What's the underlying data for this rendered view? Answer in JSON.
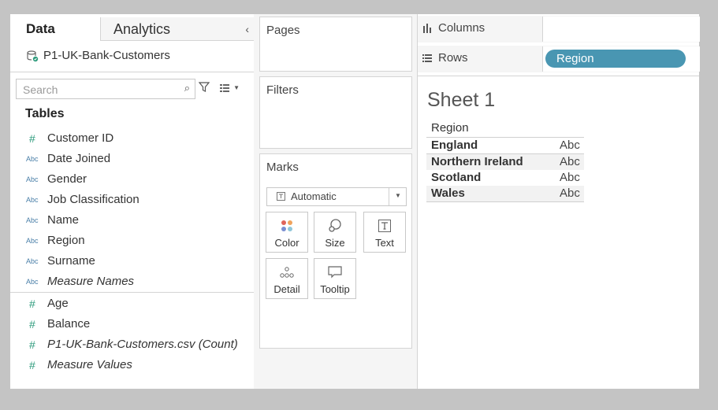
{
  "left_pane": {
    "tabs": {
      "data": "Data",
      "analytics": "Analytics"
    },
    "collapse_glyph": "‹",
    "datasource": "P1-UK-Bank-Customers",
    "search_placeholder": "Search",
    "tables_heading": "Tables",
    "dimensions": [
      {
        "icon": "#",
        "type": "number",
        "label": "Customer ID",
        "italic": false
      },
      {
        "icon": "Abc",
        "type": "string",
        "label": "Date Joined",
        "italic": false
      },
      {
        "icon": "Abc",
        "type": "string",
        "label": "Gender",
        "italic": false
      },
      {
        "icon": "Abc",
        "type": "string",
        "label": "Job Classification",
        "italic": false
      },
      {
        "icon": "Abc",
        "type": "string",
        "label": "Name",
        "italic": false
      },
      {
        "icon": "Abc",
        "type": "string",
        "label": "Region",
        "italic": false
      },
      {
        "icon": "Abc",
        "type": "string",
        "label": "Surname",
        "italic": false
      },
      {
        "icon": "Abc",
        "type": "string",
        "label": "Measure Names",
        "italic": true
      }
    ],
    "measures": [
      {
        "icon": "#",
        "type": "number",
        "label": "Age",
        "italic": false
      },
      {
        "icon": "#",
        "type": "number",
        "label": "Balance",
        "italic": false
      },
      {
        "icon": "#",
        "type": "number",
        "label": "P1-UK-Bank-Customers.csv (Count)",
        "italic": true
      },
      {
        "icon": "#",
        "type": "number",
        "label": "Measure Values",
        "italic": true
      }
    ]
  },
  "shelves": {
    "pages": "Pages",
    "filters": "Filters",
    "marks": "Marks",
    "mark_type": "Automatic",
    "mark_buttons": {
      "color": "Color",
      "size": "Size",
      "text": "Text",
      "detail": "Detail",
      "tooltip": "Tooltip"
    }
  },
  "view": {
    "columns_label": "Columns",
    "rows_label": "Rows",
    "rows_pill": "Region",
    "sheet_title": "Sheet 1",
    "table_header": "Region",
    "rows": [
      {
        "region": "England",
        "value": "Abc"
      },
      {
        "region": "Northern Ireland",
        "value": "Abc"
      },
      {
        "region": "Scotland",
        "value": "Abc"
      },
      {
        "region": "Wales",
        "value": "Abc"
      }
    ]
  },
  "colors": {
    "pill": "#4996b2",
    "number_icon": "#2d9b7c",
    "string_icon": "#4a7fa8"
  }
}
